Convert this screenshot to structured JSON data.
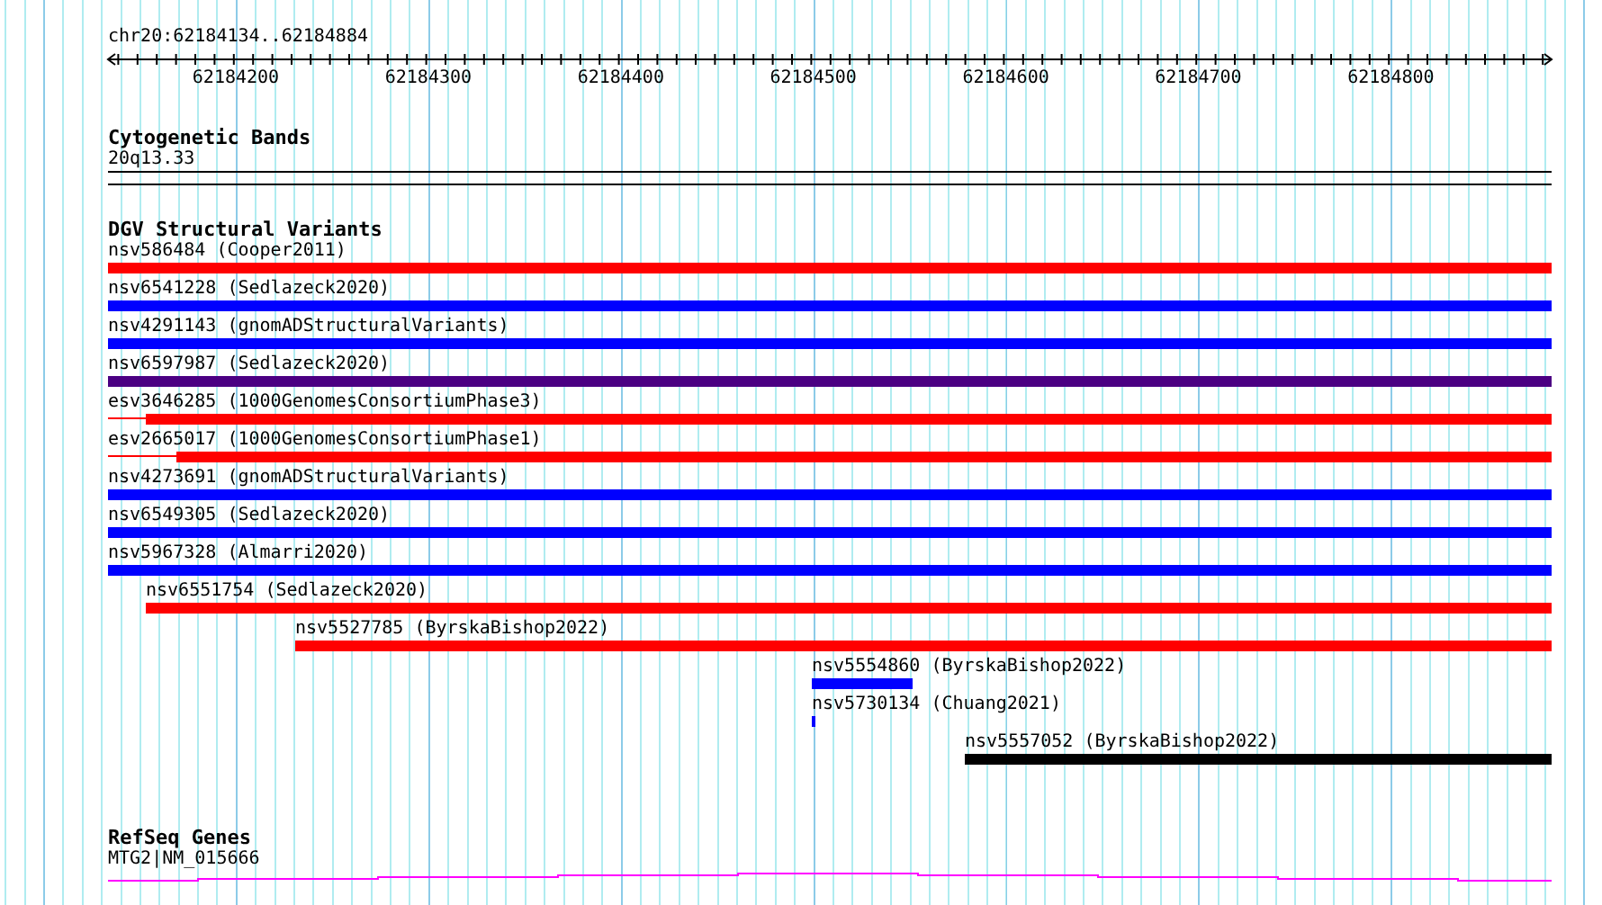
{
  "position": "chr20:62184134..62184884",
  "ruler": {
    "tick_labels": [
      "62184200",
      "62184300",
      "62184400",
      "62184500",
      "62184600",
      "62184700",
      "62184800"
    ]
  },
  "tracks": [
    {
      "kind": "bands",
      "title": "Cytogenetic Bands",
      "features": [
        {
          "label": "20q13.33"
        }
      ]
    },
    {
      "kind": "variants",
      "title": "DGV Structural Variants",
      "features": [
        {
          "label": "nsv586484 (Cooper2011)",
          "color": "#ff0000"
        },
        {
          "label": "nsv6541228 (Sedlazeck2020)",
          "color": "#0000ff"
        },
        {
          "label": "nsv4291143 (gnomADStructuralVariants)",
          "color": "#0000ff"
        },
        {
          "label": "nsv6597987 (Sedlazeck2020)",
          "color": "#4b0082"
        },
        {
          "label": "esv3646285 (1000GenomesConsortiumPhase3)",
          "color": "#ff0000"
        },
        {
          "label": "esv2665017 (1000GenomesConsortiumPhase1)",
          "color": "#ff0000"
        },
        {
          "label": "nsv4273691 (gnomADStructuralVariants)",
          "color": "#0000ff"
        },
        {
          "label": "nsv6549305 (Sedlazeck2020)",
          "color": "#0000ff"
        },
        {
          "label": "nsv5967328 (Almarri2020)",
          "color": "#0000ff"
        },
        {
          "label": "nsv6551754 (Sedlazeck2020)",
          "color": "#ff0000"
        },
        {
          "label": "nsv5527785 (ByrskaBishop2022)",
          "color": "#ff0000"
        },
        {
          "label": "nsv5554860 (ByrskaBishop2022)",
          "color": "#0000ff"
        },
        {
          "label": "nsv5730134 (Chuang2021)",
          "color": "#0000ff"
        },
        {
          "label": "nsv5557052 (ByrskaBishop2022)",
          "color": "#000000"
        }
      ]
    },
    {
      "kind": "genes",
      "title": "RefSeq Genes",
      "features": [
        {
          "label": "MTG2|NM_015666"
        }
      ]
    }
  ]
}
